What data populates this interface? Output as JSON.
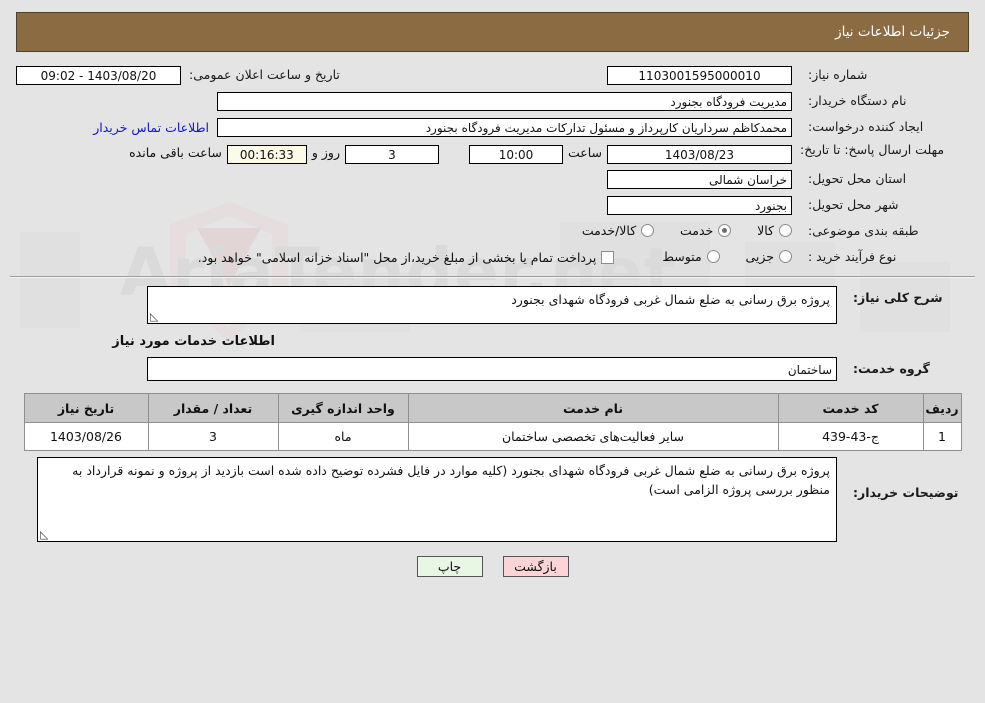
{
  "header": {
    "title": "جزئیات اطلاعات نیاز",
    "bg_color": "#8b6b42"
  },
  "form": {
    "need_number_label": "شماره نیاز:",
    "need_number_value": "1103001595000010",
    "public_announce_label": "تاریخ و ساعت اعلان عمومی:",
    "public_announce_value": "1403/08/20 - 09:02",
    "buyer_org_label": "نام دستگاه خریدار:",
    "buyer_org_value": "مدیریت فرودگاه بجنورد",
    "requester_label": "ایجاد کننده درخواست:",
    "requester_value": "محمدکاظم سرداریان کارپرداز و مسئول تدارکات مدیریت فرودگاه بجنورد",
    "contact_link": "اطلاعات تماس خریدار",
    "deadline_label": "مهلت ارسال پاسخ: تا تاریخ:",
    "deadline_date": "1403/08/23",
    "deadline_time_label": "ساعت",
    "deadline_time": "10:00",
    "days_value": "3",
    "days_label": "روز و",
    "countdown": "00:16:33",
    "remaining_label": "ساعت باقی مانده",
    "province_label": "استان محل تحویل:",
    "province_value": "خراسان شمالی",
    "city_label": "شهر محل تحویل:",
    "city_value": "بجنورد",
    "category_label": "طبقه بندی موضوعی:",
    "category_options": [
      {
        "label": "کالا",
        "selected": false
      },
      {
        "label": "خدمت",
        "selected": true
      },
      {
        "label": "کالا/خدمت",
        "selected": false
      }
    ],
    "process_label": "نوع فرآیند خرید :",
    "process_options": [
      {
        "label": "جزیی",
        "selected": false
      },
      {
        "label": "متوسط",
        "selected": false
      }
    ],
    "treasury_checkbox_checked": false,
    "treasury_note": "پرداخت تمام یا بخشی از مبلغ خرید،از محل \"اسناد خزانه اسلامی\" خواهد بود."
  },
  "summary": {
    "label": "شرح کلی نیاز:",
    "value": "پروژه برق رسانی به ضلع شمال غربی فرودگاه شهدای بجنورد"
  },
  "services": {
    "heading": "اطلاعات خدمات مورد نیاز",
    "group_label": "گروه خدمت:",
    "group_value": "ساختمان",
    "table": {
      "columns": [
        "ردیف",
        "کد خدمت",
        "نام خدمت",
        "واحد اندازه گیری",
        "تعداد / مقدار",
        "تاریخ نیاز"
      ],
      "rows": [
        {
          "row_no": "1",
          "service_code": "ج-43-439",
          "service_name": "سایر فعالیت‌های تخصصی ساختمان",
          "unit": "ماه",
          "quantity": "3",
          "need_date": "1403/08/26"
        }
      ]
    }
  },
  "notes": {
    "label": "توضیحات خریدار:",
    "value": "پروژه برق رسانی به ضلع شمال غربی فرودگاه شهدای بجنورد (کلیه موارد در فایل فشرده توضیح داده شده است بازدید از پروژه و نمونه قرارداد به منظور بررسی پروژه الزامی است)"
  },
  "buttons": {
    "print": "چاپ",
    "back": "بازگشت"
  },
  "watermark": {
    "text": "AriaTender.net"
  }
}
